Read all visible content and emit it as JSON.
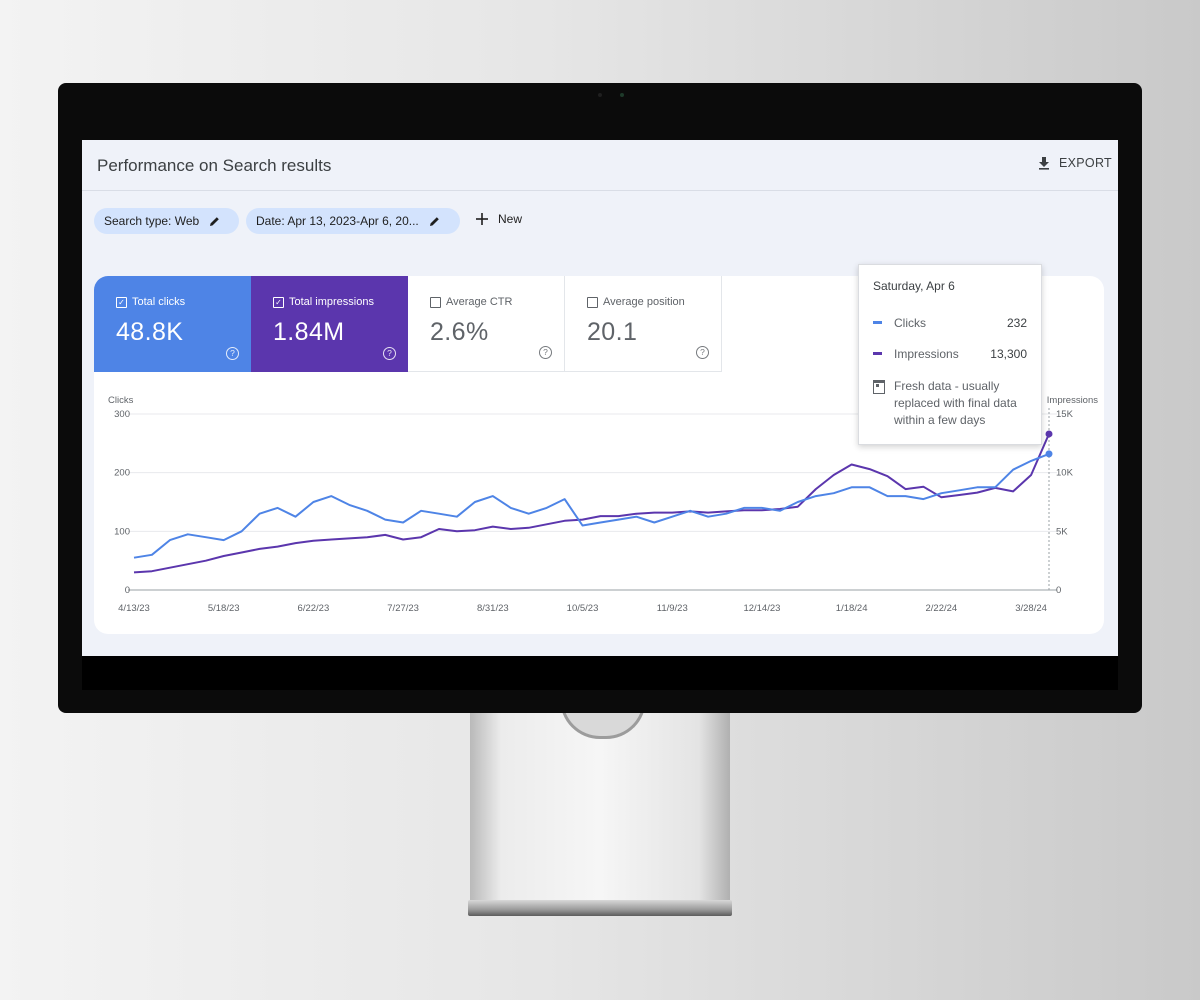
{
  "header": {
    "title": "Performance on Search results",
    "export_label": "EXPORT"
  },
  "filters": {
    "search_type": "Search type: Web",
    "date": "Date: Apr 13, 2023-Apr 6, 20...",
    "new_label": "New"
  },
  "metrics": {
    "total_clicks": {
      "label": "Total clicks",
      "value": "48.8K",
      "checked": true
    },
    "total_impressions": {
      "label": "Total impressions",
      "value": "1.84M",
      "checked": true
    },
    "average_ctr": {
      "label": "Average CTR",
      "value": "2.6%",
      "checked": false
    },
    "average_position": {
      "label": "Average position",
      "value": "20.1",
      "checked": false
    }
  },
  "tooltip": {
    "date": "Saturday, Apr 6",
    "rows": [
      {
        "name": "Clicks",
        "value": "232"
      },
      {
        "name": "Impressions",
        "value": "13,300"
      }
    ],
    "note": "Fresh data - usually replaced with final data within a few days"
  },
  "colors": {
    "clicks": "#4e84e6",
    "impressions": "#5b36ad",
    "chip": "#d3e3fd"
  },
  "icons": [
    "download-icon",
    "edit-pencil-icon",
    "plus-icon",
    "checkbox-icon",
    "help-circle-icon",
    "calendar-icon"
  ],
  "chart_data": {
    "type": "line",
    "x": [
      "4/13/23",
      "4/20/23",
      "4/27/23",
      "5/4/23",
      "5/11/23",
      "5/18/23",
      "5/25/23",
      "6/1/23",
      "6/8/23",
      "6/15/23",
      "6/22/23",
      "6/29/23",
      "7/6/23",
      "7/13/23",
      "7/20/23",
      "7/27/23",
      "8/3/23",
      "8/10/23",
      "8/17/23",
      "8/24/23",
      "8/31/23",
      "9/7/23",
      "9/14/23",
      "9/21/23",
      "9/28/23",
      "10/5/23",
      "10/12/23",
      "10/19/23",
      "10/26/23",
      "11/2/23",
      "11/9/23",
      "11/16/23",
      "11/23/23",
      "11/30/23",
      "12/7/23",
      "12/14/23",
      "12/21/23",
      "12/28/23",
      "1/4/24",
      "1/11/24",
      "1/18/24",
      "1/25/24",
      "2/1/24",
      "2/8/24",
      "2/15/24",
      "2/22/24",
      "2/29/24",
      "3/7/24",
      "3/14/24",
      "3/21/24",
      "3/28/24",
      "4/4/24"
    ],
    "x_tick_labels": [
      "4/13/23",
      "5/18/23",
      "6/22/23",
      "7/27/23",
      "8/31/23",
      "10/5/23",
      "11/9/23",
      "12/14/23",
      "1/18/24",
      "2/22/24",
      "3/28/24"
    ],
    "series": [
      {
        "name": "Clicks",
        "axis": "left",
        "values": [
          55,
          60,
          85,
          95,
          90,
          85,
          100,
          130,
          140,
          125,
          150,
          160,
          145,
          135,
          120,
          115,
          135,
          130,
          125,
          150,
          160,
          140,
          130,
          140,
          155,
          110,
          115,
          120,
          125,
          115,
          125,
          135,
          125,
          130,
          140,
          140,
          135,
          150,
          160,
          165,
          175,
          175,
          160,
          160,
          155,
          165,
          170,
          175,
          175,
          205,
          220,
          232
        ]
      },
      {
        "name": "Impressions",
        "axis": "right",
        "values": [
          1500,
          1600,
          1900,
          2200,
          2500,
          2900,
          3200,
          3500,
          3700,
          4000,
          4200,
          4300,
          4400,
          4500,
          4700,
          4300,
          4500,
          5200,
          5000,
          5100,
          5400,
          5200,
          5300,
          5600,
          5900,
          6000,
          6300,
          6300,
          6500,
          6600,
          6600,
          6700,
          6600,
          6700,
          6800,
          6800,
          6900,
          7100,
          8600,
          9800,
          10700,
          10300,
          9700,
          8600,
          8800,
          7900,
          8100,
          8300,
          8700,
          8400,
          9800,
          13300
        ]
      }
    ],
    "left_axis": {
      "label": "Clicks",
      "ylim": [
        0,
        300
      ],
      "ticks": [
        "0",
        "100",
        "200",
        "300"
      ]
    },
    "right_axis": {
      "label": "Impressions",
      "ylim": [
        0,
        15000
      ],
      "ticks": [
        "0",
        "5K",
        "10K",
        "15K"
      ]
    },
    "grid": true,
    "legend": "none"
  }
}
